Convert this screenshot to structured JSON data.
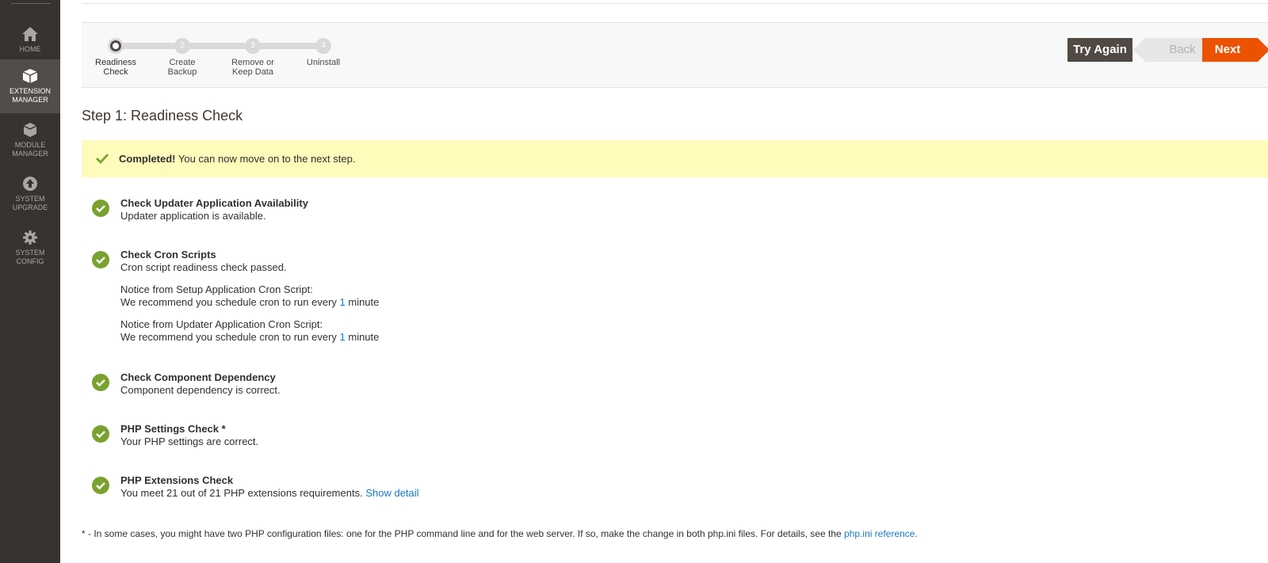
{
  "sidebar": {
    "items": [
      {
        "label": "HOME",
        "icon": "home-icon"
      },
      {
        "label": "EXTENSION MANAGER",
        "icon": "extension-box-icon"
      },
      {
        "label": "MODULE MANAGER",
        "icon": "module-cube-icon"
      },
      {
        "label": "SYSTEM UPGRADE",
        "icon": "upgrade-arrow-icon"
      },
      {
        "label": "SYSTEM CONFIG",
        "icon": "gear-icon"
      }
    ],
    "active": "EXTENSION MANAGER"
  },
  "wizard": {
    "steps": [
      {
        "number": "",
        "label_line1": "Readiness",
        "label_line2": "Check"
      },
      {
        "number": "2",
        "label_line1": "Create",
        "label_line2": "Backup"
      },
      {
        "number": "3",
        "label_line1": "Remove or",
        "label_line2": "Keep Data"
      },
      {
        "number": "4",
        "label_line1": "Uninstall",
        "label_line2": ""
      }
    ],
    "current_step": 1,
    "buttons": {
      "try_again": "Try Again",
      "back": "Back",
      "next": "Next"
    }
  },
  "page": {
    "title": "Step 1: Readiness Check"
  },
  "message": {
    "strong": "Completed!",
    "text": " You can now move on to the next step."
  },
  "checks": [
    {
      "title": "Check Updater Application Availability",
      "desc": "Updater application is available."
    },
    {
      "title": "Check Cron Scripts",
      "desc": "Cron script readiness check passed.",
      "notices": [
        {
          "line1": "Notice from Setup Application Cron Script:",
          "line2_pre": "We recommend you schedule cron to run every ",
          "line2_num": "1",
          "line2_post": " minute"
        },
        {
          "line1": "Notice from Updater Application Cron Script:",
          "line2_pre": "We recommend you schedule cron to run every ",
          "line2_num": "1",
          "line2_post": " minute"
        }
      ]
    },
    {
      "title": "Check Component Dependency",
      "desc": "Component dependency is correct."
    },
    {
      "title": "PHP Settings Check *",
      "desc": "Your PHP settings are correct."
    },
    {
      "title": "PHP Extensions Check",
      "desc": "You meet 21 out of 21 PHP extensions requirements.",
      "link": "Show detail"
    }
  ],
  "footnote": {
    "text": "* - In some cases, you might have two PHP configuration files: one for the PHP command line and for the web server. If so, make the change in both php.ini files. For details, see the ",
    "link": "php.ini reference",
    "end": "."
  },
  "colors": {
    "sidebar_bg": "#373330",
    "sidebar_active": "#524d49",
    "success_green": "#79a22e",
    "message_bg": "#fffbbb",
    "next_orange": "#eb5202",
    "try_again_bg": "#514943",
    "link_blue": "#1979c3"
  }
}
